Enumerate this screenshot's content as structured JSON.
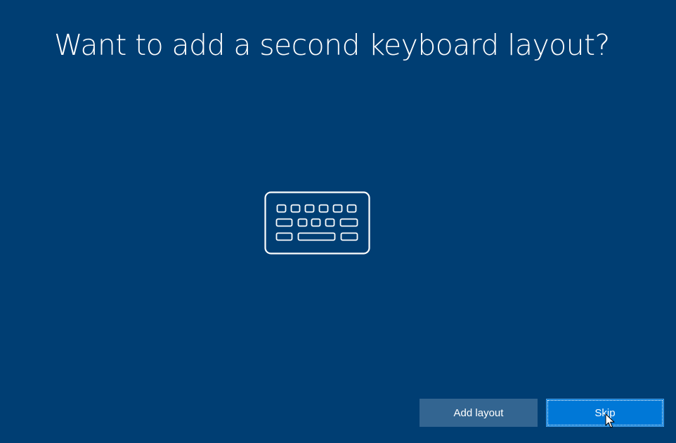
{
  "page": {
    "title": "Want to add a second keyboard layout?"
  },
  "illustration": {
    "icon": "keyboard-icon"
  },
  "actions": {
    "add_layout_label": "Add layout",
    "skip_label": "Skip",
    "focused": "skip"
  },
  "colors": {
    "background": "#003e73",
    "primary_button": "#0078d7",
    "secondary_button": "#336591",
    "text": "#ffffff"
  }
}
